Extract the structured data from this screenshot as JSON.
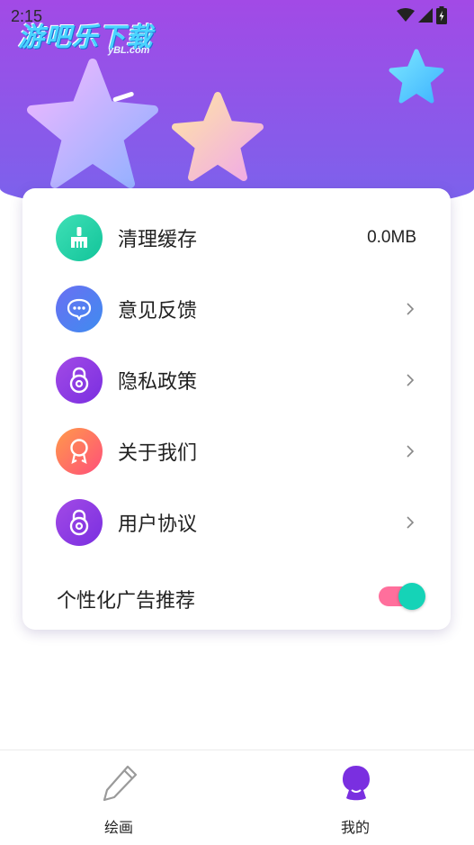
{
  "status_bar": {
    "time": "2:15",
    "icons": [
      "wifi-icon",
      "signal-icon",
      "battery-icon"
    ]
  },
  "watermark": {
    "main": "游吧乐下载",
    "sub": "yBL.com"
  },
  "menu": {
    "items": [
      {
        "label": "清理缓存",
        "value": "0.0MB",
        "icon": "broom-icon",
        "color": "#1ccfa4"
      },
      {
        "label": "意见反馈",
        "icon": "chat-bubble-icon",
        "color": "#4f7cf0"
      },
      {
        "label": "隐私政策",
        "icon": "lock-icon",
        "color": "#8a3fe0"
      },
      {
        "label": "关于我们",
        "icon": "badge-icon",
        "color": "#ff6a5a"
      },
      {
        "label": "用户协议",
        "icon": "lock-icon",
        "color": "#8a3fe0"
      }
    ],
    "ad_toggle": {
      "label": "个性化广告推荐",
      "on": true
    }
  },
  "tabbar": {
    "tabs": [
      {
        "label": "绘画",
        "icon": "pencil-icon",
        "active": false
      },
      {
        "label": "我的",
        "icon": "profile-icon",
        "active": true
      }
    ]
  },
  "colors": {
    "header_top": "#a24ae6",
    "header_bottom": "#7a63ec",
    "toggle_track": "#ff6f9c",
    "toggle_knob": "#15d3b7",
    "active_tab_icon": "#7a2fe0"
  }
}
